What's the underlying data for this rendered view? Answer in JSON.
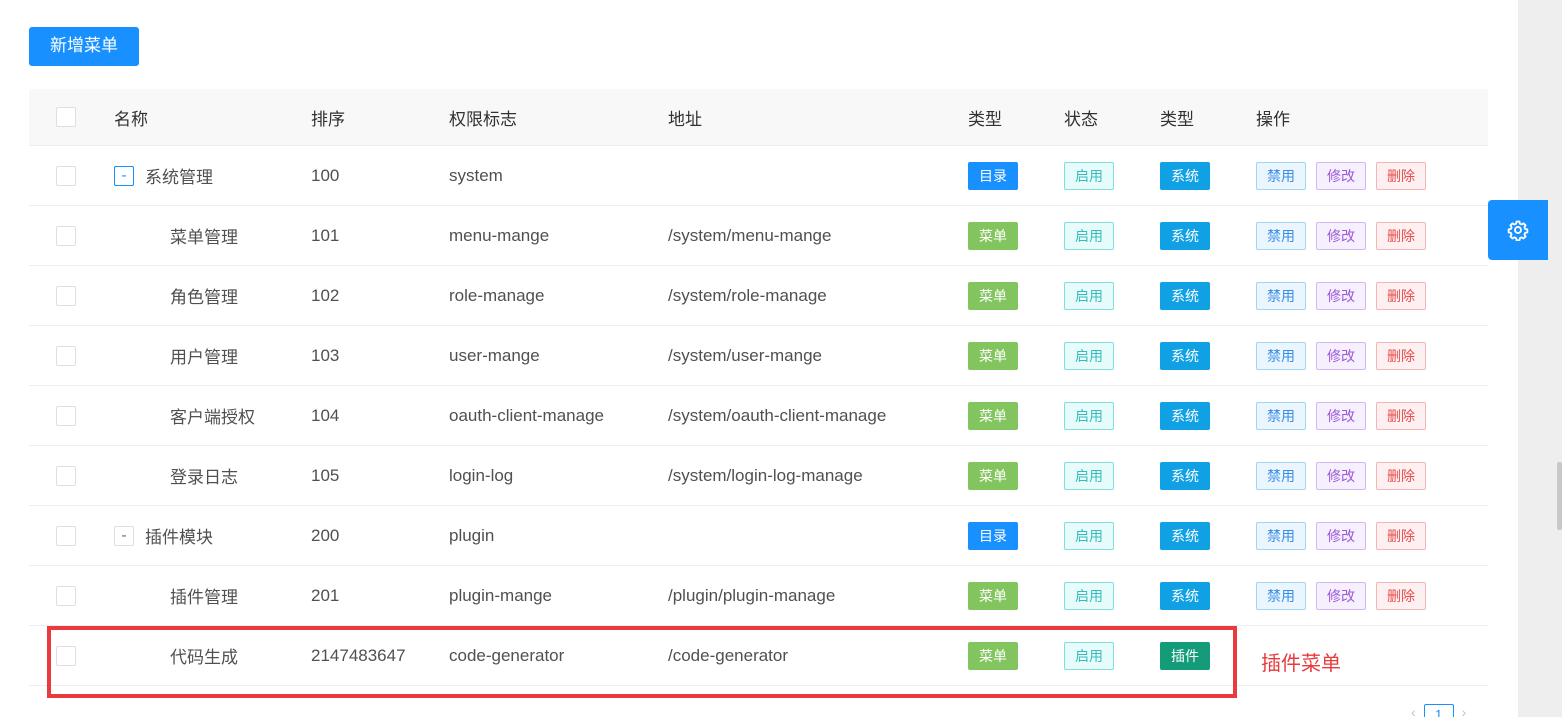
{
  "toolbar": {
    "add_menu_label": "新增菜单"
  },
  "table": {
    "headers": {
      "name": "名称",
      "order": "排序",
      "permission": "权限标志",
      "url": "地址",
      "type": "类型",
      "status": "状态",
      "type2": "类型",
      "ops": "操作"
    },
    "rows": [
      {
        "name": "系统管理",
        "toggle": "-",
        "order": "100",
        "permission": "system",
        "url": "",
        "type": "目录",
        "status": "启用",
        "type2": "系统",
        "disable": "禁用",
        "edit": "修改",
        "delete": "删除"
      },
      {
        "name": "菜单管理",
        "order": "101",
        "permission": "menu-mange",
        "url": "/system/menu-mange",
        "type": "菜单",
        "status": "启用",
        "type2": "系统",
        "disable": "禁用",
        "edit": "修改",
        "delete": "删除"
      },
      {
        "name": "角色管理",
        "order": "102",
        "permission": "role-manage",
        "url": "/system/role-manage",
        "type": "菜单",
        "status": "启用",
        "type2": "系统",
        "disable": "禁用",
        "edit": "修改",
        "delete": "删除"
      },
      {
        "name": "用户管理",
        "order": "103",
        "permission": "user-mange",
        "url": "/system/user-mange",
        "type": "菜单",
        "status": "启用",
        "type2": "系统",
        "disable": "禁用",
        "edit": "修改",
        "delete": "删除"
      },
      {
        "name": "客户端授权",
        "order": "104",
        "permission": "oauth-client-manage",
        "url": "/system/oauth-client-manage",
        "type": "菜单",
        "status": "启用",
        "type2": "系统",
        "disable": "禁用",
        "edit": "修改",
        "delete": "删除"
      },
      {
        "name": "登录日志",
        "order": "105",
        "permission": "login-log",
        "url": "/system/login-log-manage",
        "type": "菜单",
        "status": "启用",
        "type2": "系统",
        "disable": "禁用",
        "edit": "修改",
        "delete": "删除"
      },
      {
        "name": "插件模块",
        "toggle": "-",
        "order": "200",
        "permission": "plugin",
        "url": "",
        "type": "目录",
        "status": "启用",
        "type2": "系统",
        "disable": "禁用",
        "edit": "修改",
        "delete": "删除"
      },
      {
        "name": "插件管理",
        "order": "201",
        "permission": "plugin-mange",
        "url": "/plugin/plugin-manage",
        "type": "菜单",
        "status": "启用",
        "type2": "系统",
        "disable": "禁用",
        "edit": "修改",
        "delete": "删除"
      },
      {
        "name": "代码生成",
        "order": "2147483647",
        "permission": "code-generator",
        "url": "/code-generator",
        "type": "菜单",
        "status": "启用",
        "type2": "插件"
      }
    ]
  },
  "annotation": {
    "text": "插件菜单"
  },
  "pagination": {
    "current_page": "1"
  },
  "icons": {
    "settings": "gear-icon",
    "prev": "chevron-left-icon",
    "next": "chevron-right-icon"
  },
  "colors": {
    "primary": "#1890ff",
    "highlight": "#ea3a3d",
    "menu_tag": "#82c55e",
    "system_tag": "#0fa1e4",
    "plugin_tag": "#139b7a"
  }
}
